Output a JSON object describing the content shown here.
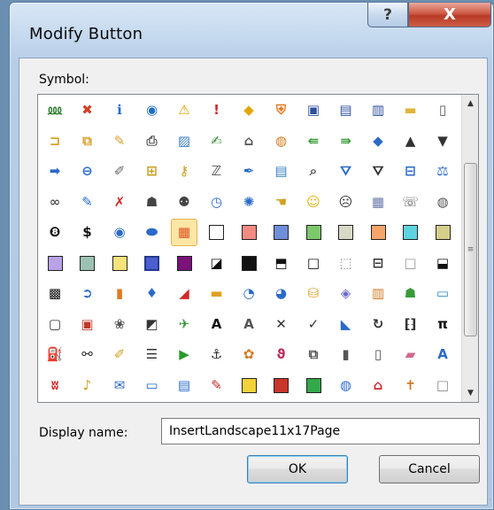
{
  "window": {
    "title": "Modify Button"
  },
  "titlebar": {
    "help_glyph": "?",
    "close_glyph": "X"
  },
  "symbol_label": "Symbol:",
  "display_name": {
    "label": "Display name:",
    "value": "InsertLandscape11x17Page"
  },
  "buttons": {
    "ok": "OK",
    "cancel": "Cancel"
  },
  "scrollbar": {
    "up_glyph": "▲",
    "down_glyph": "▼",
    "grip_glyph": "≡"
  },
  "selected_symbol": {
    "row": 4,
    "col": 4
  },
  "symbols": [
    [
      {
        "name": "org-chart-icon",
        "g": "⅏",
        "c": "#2a7a2a"
      },
      {
        "name": "error-icon",
        "g": "✖",
        "c": "#d0402a"
      },
      {
        "name": "info-icon",
        "g": "ℹ",
        "c": "#1e6fc8"
      },
      {
        "name": "target-icon",
        "g": "◉",
        "c": "#1e6fc8"
      },
      {
        "name": "warning-icon",
        "g": "⚠",
        "c": "#d6a300"
      },
      {
        "name": "exclamation-icon",
        "g": "!",
        "c": "#d02a2a"
      },
      {
        "name": "warning-diamond-icon",
        "g": "◆",
        "c": "#e0a800"
      },
      {
        "name": "shield-icon",
        "g": "⛨",
        "c": "#e07a20"
      },
      {
        "name": "save-icon",
        "g": "▣",
        "c": "#2b4f9a"
      },
      {
        "name": "save-as-icon",
        "g": "▤",
        "c": "#2b4f9a"
      },
      {
        "name": "save-all-icon",
        "g": "▥",
        "c": "#2b4f9a"
      },
      {
        "name": "folder-icon",
        "g": "▬",
        "c": "#e2b43a"
      },
      {
        "name": "blank-page-icon",
        "g": "▯",
        "c": "#555555"
      }
    ],
    [
      {
        "name": "open-folder-icon",
        "g": "⊐",
        "c": "#d9a12a"
      },
      {
        "name": "copy-folder-icon",
        "g": "⧉",
        "c": "#d9a12a"
      },
      {
        "name": "edit-folder-icon",
        "g": "✎",
        "c": "#d9a12a"
      },
      {
        "name": "print-icon",
        "g": "⎙",
        "c": "#555555"
      },
      {
        "name": "picture-icon",
        "g": "▨",
        "c": "#3b7dbf"
      },
      {
        "name": "edit-doc-icon",
        "g": "✍",
        "c": "#3a8a3a"
      },
      {
        "name": "home-icon",
        "g": "⌂",
        "c": "#555555"
      },
      {
        "name": "palette-icon",
        "g": "◍",
        "c": "#d07a20"
      },
      {
        "name": "back-green-icon",
        "g": "⇚",
        "c": "#3a9a3a"
      },
      {
        "name": "forward-green-icon",
        "g": "⇛",
        "c": "#3a9a3a"
      },
      {
        "name": "left-arrow-icon",
        "g": "◆",
        "c": "#2a6ac8"
      },
      {
        "name": "up-arrow-icon",
        "g": "▲",
        "c": "#333333"
      },
      {
        "name": "down-arrow-icon",
        "g": "▼",
        "c": "#333333"
      }
    ],
    [
      {
        "name": "right-arrow-icon",
        "g": "➡",
        "c": "#2a6ac8"
      },
      {
        "name": "back-circle-icon",
        "g": "⊖",
        "c": "#2a6ac8"
      },
      {
        "name": "pin-icon",
        "g": "✐",
        "c": "#666666"
      },
      {
        "name": "lock-icon",
        "g": "⊞",
        "c": "#c9a020"
      },
      {
        "name": "key-icon",
        "g": "⚷",
        "c": "#c9a020"
      },
      {
        "name": "sleep-icon",
        "g": "ℤ",
        "c": "#555555"
      },
      {
        "name": "pen-icon",
        "g": "✒",
        "c": "#2a6ac8"
      },
      {
        "name": "form-icon",
        "g": "▤",
        "c": "#3b7dbf"
      },
      {
        "name": "search-icon",
        "g": "⌕",
        "c": "#555555"
      },
      {
        "name": "filter-icon",
        "g": "⛛",
        "c": "#2a6ac8"
      },
      {
        "name": "filter-clear-icon",
        "g": "⛛",
        "c": "#333333"
      },
      {
        "name": "book-icon",
        "g": "⊟",
        "c": "#2a6ac8"
      },
      {
        "name": "scales-icon",
        "g": "⚖",
        "c": "#2a6ac8"
      }
    ],
    [
      {
        "name": "link-icon",
        "g": "∞",
        "c": "#555555"
      },
      {
        "name": "microphone-icon",
        "g": "✎",
        "c": "#2a6ac8"
      },
      {
        "name": "no-touch-icon",
        "g": "✗",
        "c": "#d02a2a"
      },
      {
        "name": "user-icon",
        "g": "☗",
        "c": "#444444"
      },
      {
        "name": "users-icon",
        "g": "⚉",
        "c": "#444444"
      },
      {
        "name": "clock-icon",
        "g": "◷",
        "c": "#2a6ac8"
      },
      {
        "name": "burst-icon",
        "g": "✺",
        "c": "#2a6ac8"
      },
      {
        "name": "hand-icon",
        "g": "☚",
        "c": "#d0a020"
      },
      {
        "name": "smile-icon",
        "g": "☺",
        "c": "#e0b000"
      },
      {
        "name": "sad-icon",
        "g": "☹",
        "c": "#333333"
      },
      {
        "name": "calculator-icon",
        "g": "▦",
        "c": "#6a7aaa"
      },
      {
        "name": "phone-icon",
        "g": "☏",
        "c": "#555555"
      },
      {
        "name": "piggy-bank-icon",
        "g": "◍",
        "c": "#555555"
      }
    ],
    [
      {
        "name": "eight-ball-icon",
        "g": "❽",
        "c": "#111111"
      },
      {
        "name": "dollar-icon",
        "g": "$",
        "c": "#111111"
      },
      {
        "name": "eye-icon",
        "g": "◉",
        "c": "#2a6ac8"
      },
      {
        "name": "ellipse-icon",
        "g": "⬬",
        "c": "#2a6ac8"
      },
      {
        "name": "windows-icon",
        "g": "▦",
        "c": "#e05020"
      },
      {
        "name": "swatch-white-icon",
        "sw": "#ffffff"
      },
      {
        "name": "swatch-salmon-icon",
        "sw": "#f28b82"
      },
      {
        "name": "swatch-blue-icon",
        "sw": "#6f8fd8"
      },
      {
        "name": "swatch-green-icon",
        "sw": "#7cc86a"
      },
      {
        "name": "swatch-tan-icon",
        "sw": "#d9d9c8"
      },
      {
        "name": "swatch-orange-icon",
        "sw": "#f7a46a"
      },
      {
        "name": "swatch-cyan-icon",
        "sw": "#5fd3e0"
      },
      {
        "name": "swatch-khaki-icon",
        "sw": "#d6cf8a"
      }
    ],
    [
      {
        "name": "swatch-lavender-icon",
        "sw": "#b9a2e8"
      },
      {
        "name": "swatch-sage-icon",
        "sw": "#9cc2b4"
      },
      {
        "name": "swatch-yellow-icon",
        "sw": "#f6e27a"
      },
      {
        "name": "swatch-selected-blue-icon",
        "sw": "#4b5fd0",
        "sel": true
      },
      {
        "name": "swatch-purple-icon",
        "sw": "#7a127a"
      },
      {
        "name": "half-fill-icon",
        "g": "◪",
        "c": "#111111"
      },
      {
        "name": "swatch-black-icon",
        "sw": "#111111"
      },
      {
        "name": "bottom-half-icon",
        "g": "⬒",
        "c": "#111111"
      },
      {
        "name": "outline-box-icon",
        "g": "□",
        "c": "#111111"
      },
      {
        "name": "dotted-box-icon",
        "g": "⬚",
        "c": "#888888"
      },
      {
        "name": "bar-box-icon",
        "g": "⊟",
        "c": "#333333"
      },
      {
        "name": "empty-box-icon",
        "g": "□",
        "c": "#999999"
      },
      {
        "name": "top-bar-box-icon",
        "g": "⬓",
        "c": "#111111"
      }
    ],
    [
      {
        "name": "checkerboard-icon",
        "g": "▩",
        "c": "#111111"
      },
      {
        "name": "arrow-circle-icon",
        "g": "➲",
        "c": "#2a6ac8"
      },
      {
        "name": "bar-chart-icon",
        "g": "▮",
        "c": "#e07a20"
      },
      {
        "name": "drop-icon",
        "g": "♦",
        "c": "#2a6ac8"
      },
      {
        "name": "line-chart-icon",
        "g": "◢",
        "c": "#d02a2a"
      },
      {
        "name": "stacked-bar-icon",
        "g": "▬",
        "c": "#e0a020"
      },
      {
        "name": "pie-icon",
        "g": "◔",
        "c": "#2a6ac8"
      },
      {
        "name": "donut-icon",
        "g": "◕",
        "c": "#2a6ac8"
      },
      {
        "name": "cylinder-icon",
        "g": "⛁",
        "c": "#e0a020"
      },
      {
        "name": "layers-icon",
        "g": "◈",
        "c": "#6a6ac8"
      },
      {
        "name": "books-icon",
        "g": "▥",
        "c": "#d07a20"
      },
      {
        "name": "people-icon",
        "g": "☗",
        "c": "#3a9a3a"
      },
      {
        "name": "landscape-icon",
        "g": "▭",
        "c": "#2a8ac8"
      }
    ],
    [
      {
        "name": "frame-icon",
        "g": "▢",
        "c": "#333333"
      },
      {
        "name": "photo-icon",
        "g": "▣",
        "c": "#c0392b"
      },
      {
        "name": "gallery-icon",
        "g": "❀",
        "c": "#555555"
      },
      {
        "name": "chart-slash-icon",
        "g": "◩",
        "c": "#333333"
      },
      {
        "name": "bird-icon",
        "g": "✈",
        "c": "#3a9a3a"
      },
      {
        "name": "text-a-icon",
        "g": "A",
        "c": "#111111"
      },
      {
        "name": "text-a-shade-icon",
        "g": "A",
        "c": "#555555"
      },
      {
        "name": "cross-icon",
        "g": "✕",
        "c": "#333333"
      },
      {
        "name": "check-icon",
        "g": "✓",
        "c": "#333333"
      },
      {
        "name": "ruler-icon",
        "g": "◣",
        "c": "#2a6ac8"
      },
      {
        "name": "refresh-icon",
        "g": "↻",
        "c": "#333333"
      },
      {
        "name": "binary-icon",
        "g": "⁅⁆",
        "c": "#333333"
      },
      {
        "name": "pi-icon",
        "g": "π",
        "c": "#111111"
      }
    ],
    [
      {
        "name": "paint-bucket-icon",
        "g": "⛽",
        "c": "#d0a020"
      },
      {
        "name": "binoculars-icon",
        "g": "⚯",
        "c": "#333333"
      },
      {
        "name": "broom-icon",
        "g": "✐",
        "c": "#d0a020"
      },
      {
        "name": "list-icon",
        "g": "☰",
        "c": "#333333"
      },
      {
        "name": "play-icon",
        "g": "▶",
        "c": "#2a9a2a"
      },
      {
        "name": "anchor-icon",
        "g": "⚓",
        "c": "#333333"
      },
      {
        "name": "stamp-icon",
        "g": "✿",
        "c": "#d07a20"
      },
      {
        "name": "lasso-icon",
        "g": "ϑ",
        "c": "#c02a5a"
      },
      {
        "name": "copy-icon",
        "g": "⧉",
        "c": "#555555"
      },
      {
        "name": "flash-drive-icon",
        "g": "▮",
        "c": "#555555"
      },
      {
        "name": "notepad-icon",
        "g": "▯",
        "c": "#555555"
      },
      {
        "name": "eraser-icon",
        "g": "▰",
        "c": "#d06a8a"
      },
      {
        "name": "font-icon",
        "g": "A",
        "c": "#2a6ac8"
      }
    ],
    [
      {
        "name": "butterfly-icon",
        "g": "ʬ",
        "c": "#d02a2a"
      },
      {
        "name": "bell-icon",
        "g": "♪",
        "c": "#d0a020"
      },
      {
        "name": "envelope-icon",
        "g": "✉",
        "c": "#2a6ac8"
      },
      {
        "name": "card-icon",
        "g": "▭",
        "c": "#2a6ac8"
      },
      {
        "name": "window-icon",
        "g": "▤",
        "c": "#2a6ac8"
      },
      {
        "name": "edit-window-icon",
        "g": "✎",
        "c": "#c02a2a"
      },
      {
        "name": "yellow-square-icon",
        "sw": "#f3d23a"
      },
      {
        "name": "red-square-icon",
        "sw": "#c9352a"
      },
      {
        "name": "green-square-icon",
        "sw": "#34a84a"
      },
      {
        "name": "globe-icon",
        "g": "◍",
        "c": "#2a6ac8"
      },
      {
        "name": "home-globe-icon",
        "g": "⌂",
        "c": "#d02a2a"
      },
      {
        "name": "signpost-icon",
        "g": "✝",
        "c": "#d07a20"
      },
      {
        "name": "blank-square-icon",
        "g": "□",
        "c": "#888888"
      }
    ]
  ]
}
